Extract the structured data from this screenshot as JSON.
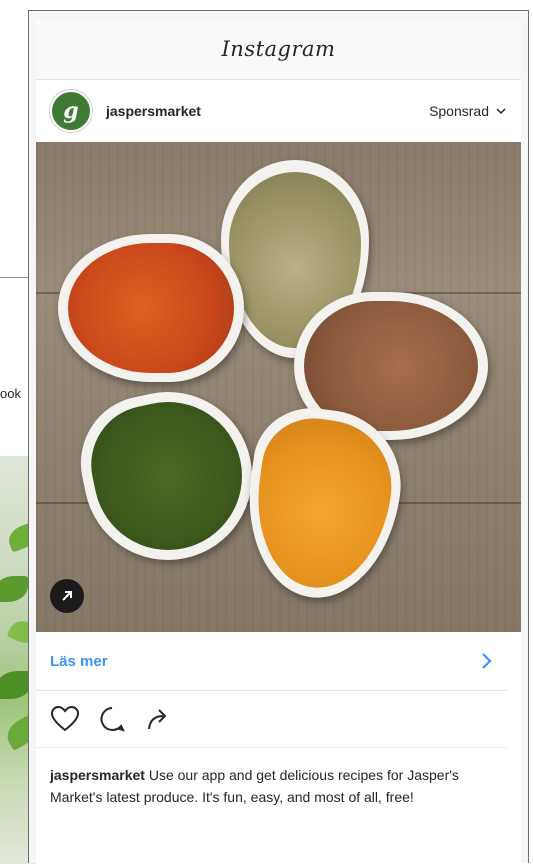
{
  "background": {
    "partial_text": "ook"
  },
  "header": {
    "app_name": "Instagram"
  },
  "post": {
    "username": "jaspersmarket",
    "avatar_letter": "g",
    "sponsored_label": "Sponsrad",
    "image_icon": "external-link-arrow-icon",
    "cta_label": "Läs mer",
    "actions": [
      "heart-icon",
      "comment-icon",
      "share-icon"
    ],
    "caption_user": "jaspersmarket",
    "caption_text": " Use our app and get delicious recipes for Jasper's Market's latest produce. It's fun, easy, and most of all, free!"
  },
  "colors": {
    "link_blue": "#3897f0",
    "brand_green": "#3f7b34"
  }
}
